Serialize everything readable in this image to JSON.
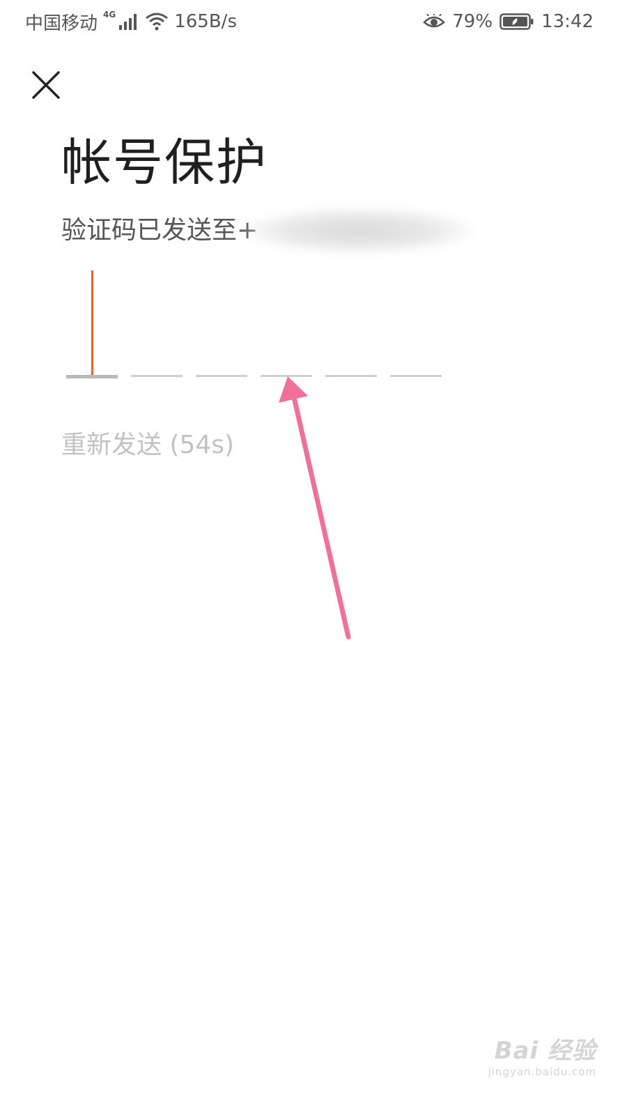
{
  "status_bar": {
    "carrier": "中国移动",
    "network_type": "4G",
    "net_speed": "165B/s",
    "battery_percent": "79%",
    "time": "13:42",
    "icons": [
      "signal-icon",
      "wifi-icon",
      "eye-comfort-icon",
      "battery-icon"
    ]
  },
  "header": {
    "close_icon": "close-icon"
  },
  "main": {
    "title": "帐号保护",
    "subtitle": "验证码已发送至+",
    "code_length": 6,
    "entered_code": "",
    "resend_label": "重新发送 (54s)"
  },
  "watermark": {
    "main": "Bai 经验",
    "sub": "jingyan.baidu.com"
  },
  "colors": {
    "cursor": "#e0662a",
    "arrow": "#f0709a",
    "slot": "#cfcfcf",
    "resend_disabled": "#c2c2c2"
  }
}
